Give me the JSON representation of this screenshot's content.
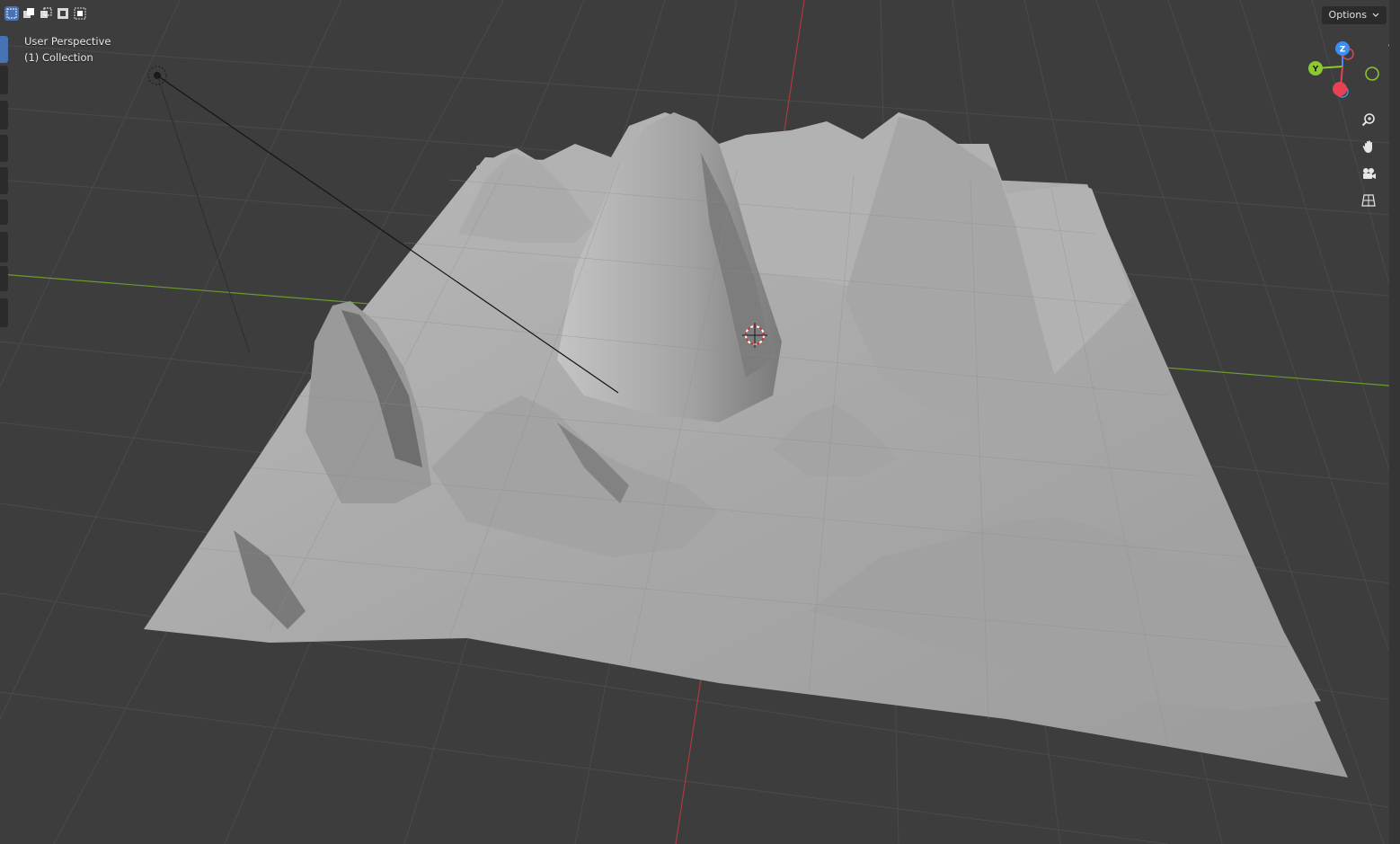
{
  "viewport": {
    "view_name": "User Perspective",
    "collection": "(1) Collection"
  },
  "header": {
    "options_label": "Options"
  },
  "colors": {
    "background": "#3d3d3d",
    "grid": "#4b4b4b",
    "x_axis": "#b03a3a",
    "y_axis": "#6a9a2a",
    "mesh": "#a9a9a9",
    "accent": "#4772b3"
  },
  "gizmo": {
    "z_label": "Z",
    "y_label": "Y",
    "x_color": "#e44355",
    "y_color": "#8ec831",
    "z_color": "#3e8ef0"
  },
  "select_modes": [
    "set",
    "extend",
    "subtract",
    "invert",
    "intersect"
  ],
  "nav_tools": [
    "zoom-icon",
    "pan-hand-icon",
    "camera-icon",
    "grid-view-icon"
  ]
}
